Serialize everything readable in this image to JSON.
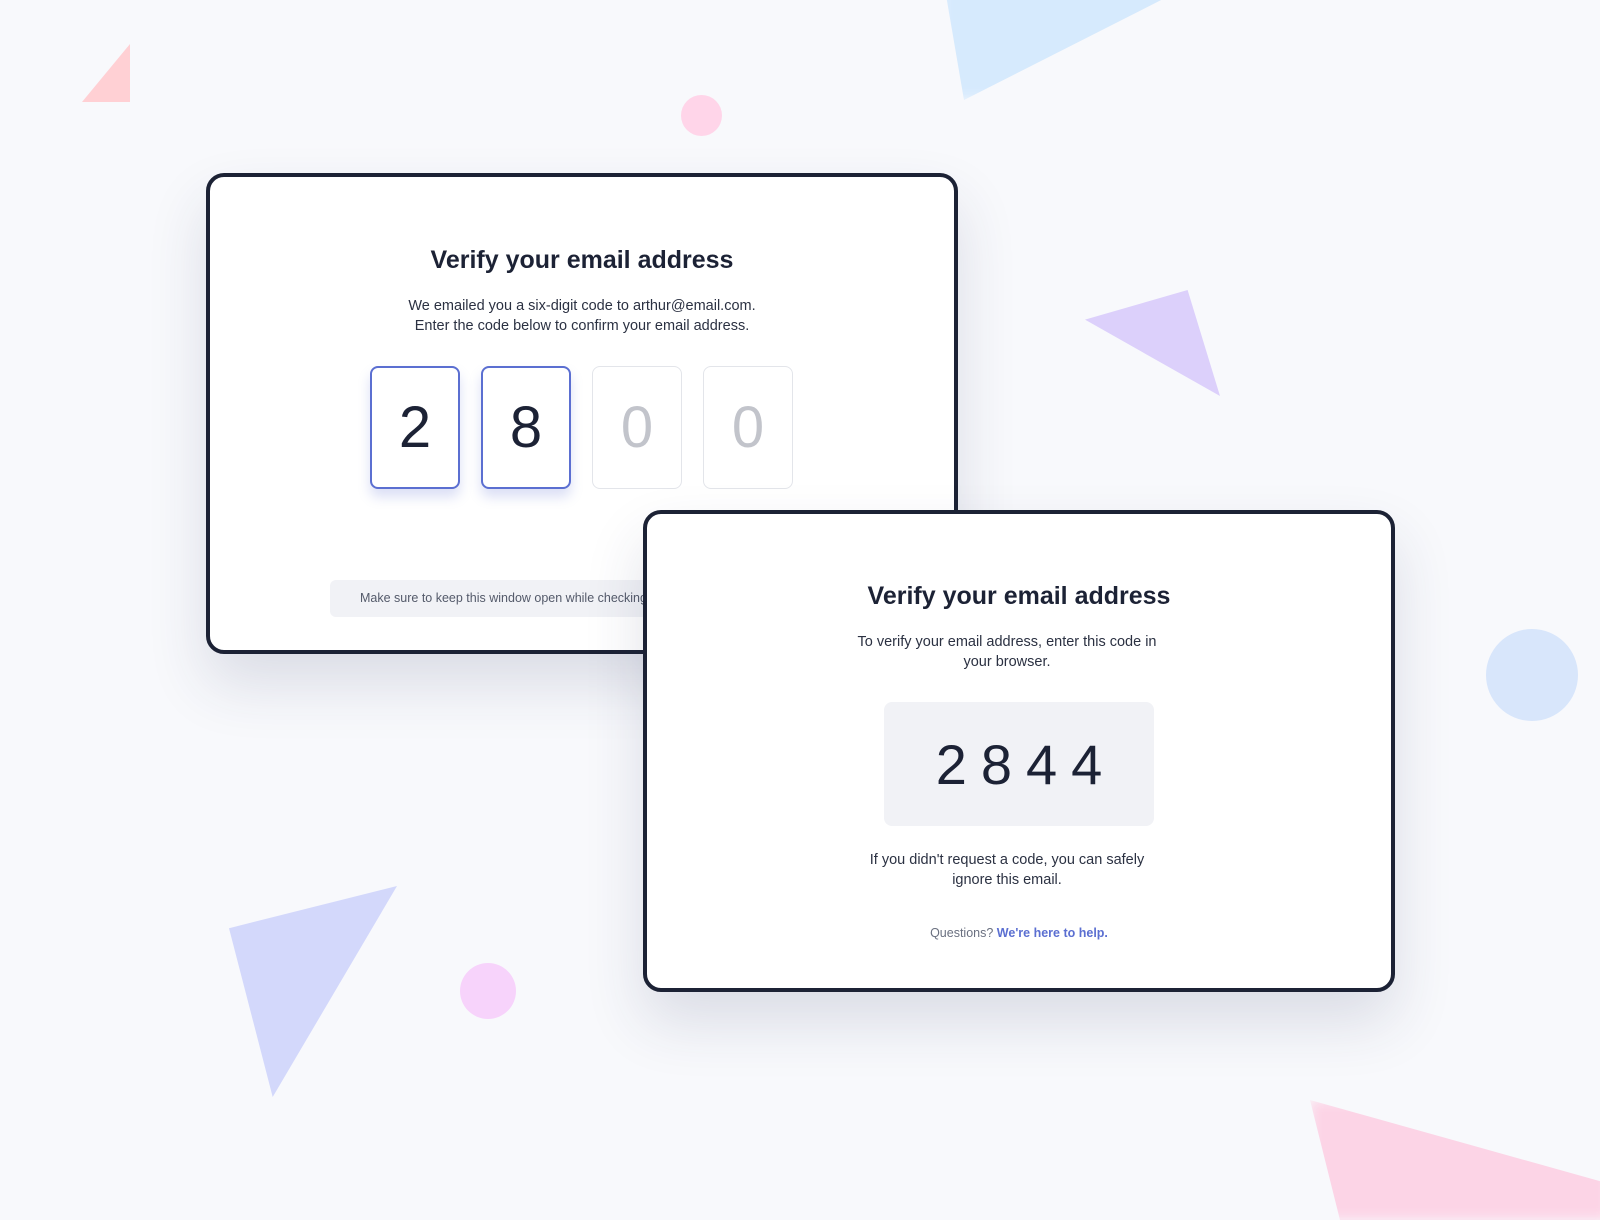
{
  "card_code_entry": {
    "title": "Verify your email address",
    "description_line1": "We emailed you a six-digit code to arthur@email.com.",
    "description_line2": "Enter the code below to confirm your email address.",
    "digits": [
      "2",
      "8",
      "0",
      "0"
    ],
    "note": "Make sure to keep this window open while checking your inbox."
  },
  "card_email": {
    "title": "Verify your email address",
    "description": "To verify your email address, enter this code in your browser.",
    "code": "2844",
    "ignore_text": "If you didn't request a code, you can safely ignore this email.",
    "help_prefix": "Questions?",
    "help_link": "We're here to help."
  },
  "colors": {
    "accent": "#5b6fd1",
    "border": "#1c2235",
    "background": "#f8f9fc"
  }
}
